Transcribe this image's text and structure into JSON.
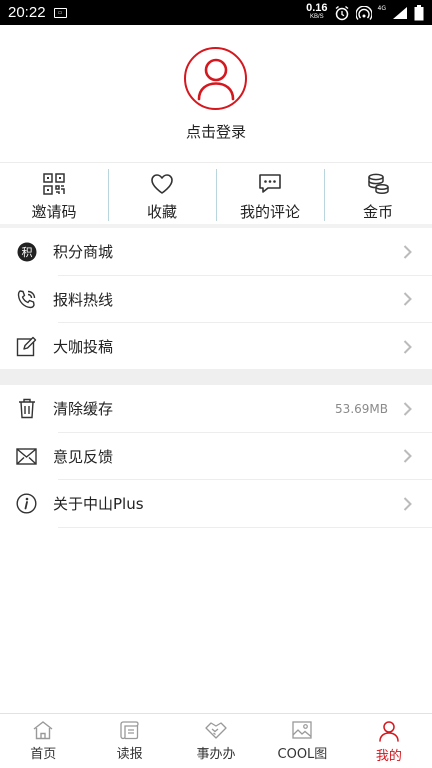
{
  "status_bar": {
    "time": "20:22",
    "net_speed_value": "0.16",
    "net_speed_unit": "KB/S",
    "network_type": "4G"
  },
  "profile": {
    "login_prompt": "点击登录"
  },
  "quick_actions": [
    {
      "label": "邀请码",
      "icon": "qr-code-icon"
    },
    {
      "label": "收藏",
      "icon": "heart-icon"
    },
    {
      "label": "我的评论",
      "icon": "comment-icon"
    },
    {
      "label": "金币",
      "icon": "coins-icon"
    }
  ],
  "menu_group_1": [
    {
      "label": "积分商城",
      "icon": "points-mall-icon",
      "icon_char": "积"
    },
    {
      "label": "报料热线",
      "icon": "phone-icon"
    },
    {
      "label": "大咖投稿",
      "icon": "edit-icon"
    }
  ],
  "menu_group_2": [
    {
      "label": "清除缓存",
      "icon": "trash-icon",
      "value": "53.69MB"
    },
    {
      "label": "意见反馈",
      "icon": "mail-icon"
    },
    {
      "label": "关于中山Plus",
      "icon": "info-icon"
    }
  ],
  "tab_bar": {
    "tabs": [
      {
        "label": "首页",
        "icon": "home-icon"
      },
      {
        "label": "读报",
        "icon": "newspaper-icon"
      },
      {
        "label": "事办办",
        "icon": "handshake-icon"
      },
      {
        "label": "COOL图",
        "icon": "image-icon"
      },
      {
        "label": "我的",
        "icon": "user-icon"
      }
    ],
    "active_index": 4
  },
  "colors": {
    "accent": "#d5171e",
    "divider": "#ededed",
    "section_gap": "#efefef"
  }
}
